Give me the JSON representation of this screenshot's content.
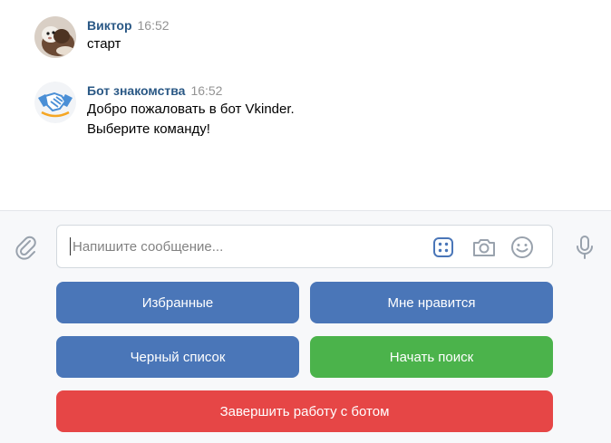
{
  "messages": [
    {
      "author": "Виктор",
      "time": "16:52",
      "lines": [
        "старт"
      ],
      "avatar_icon": "ferret-photo-avatar"
    },
    {
      "author": "Бот знакомства",
      "time": "16:52",
      "lines": [
        "Добро пожаловать в бот Vkinder.",
        "Выберите команду!"
      ],
      "avatar_icon": "handshake-avatar"
    }
  ],
  "composer": {
    "placeholder": "Напишите сообщение...",
    "value": "",
    "icons": [
      "paperclip-icon",
      "keyboard-icon",
      "camera-icon",
      "smile-icon",
      "microphone-icon"
    ]
  },
  "keyboard": {
    "buttons": [
      {
        "label": "Избранные",
        "color": "#4a76b8"
      },
      {
        "label": "Мне нравится",
        "color": "#4a76b8"
      },
      {
        "label": "Черный список",
        "color": "#4a76b8"
      },
      {
        "label": "Начать поиск",
        "color": "#4bb34b"
      },
      {
        "label": "Завершить работу с ботом",
        "color": "#e64646"
      }
    ]
  },
  "colors": {
    "author": "#2a5885",
    "time": "#939393",
    "accent": "#4a76b8"
  }
}
